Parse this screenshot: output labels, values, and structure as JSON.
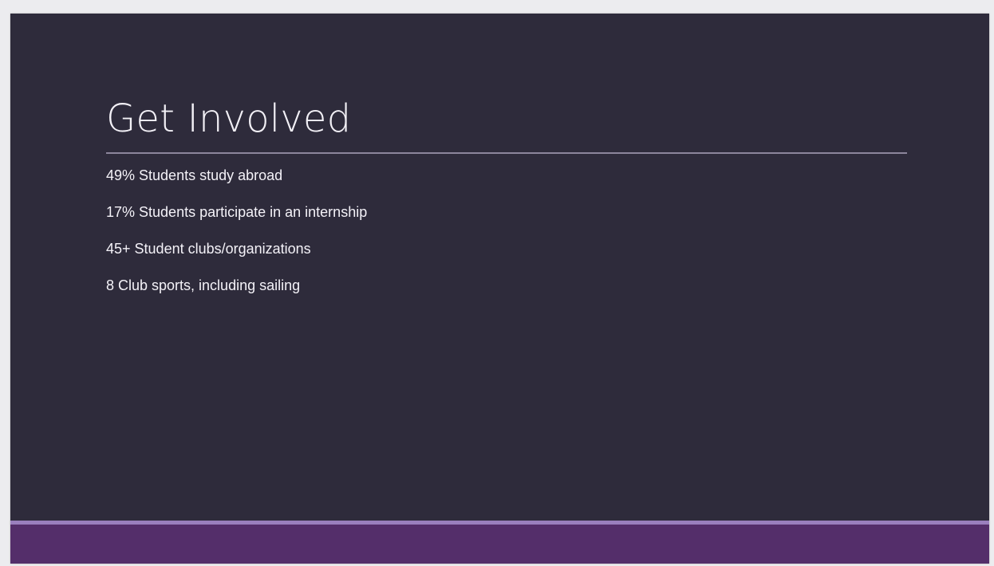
{
  "slide": {
    "title": "Get Involved",
    "bullets": [
      "49% Students study abroad",
      "17% Students participate in an internship",
      "45+ Student clubs/organizations",
      "8 Club sports, including sailing"
    ]
  },
  "colors": {
    "background": "#2e2b3b",
    "accent_bar": "#542e6a",
    "accent_stripe": "#9a7fbd",
    "text": "#f4f2f8"
  }
}
